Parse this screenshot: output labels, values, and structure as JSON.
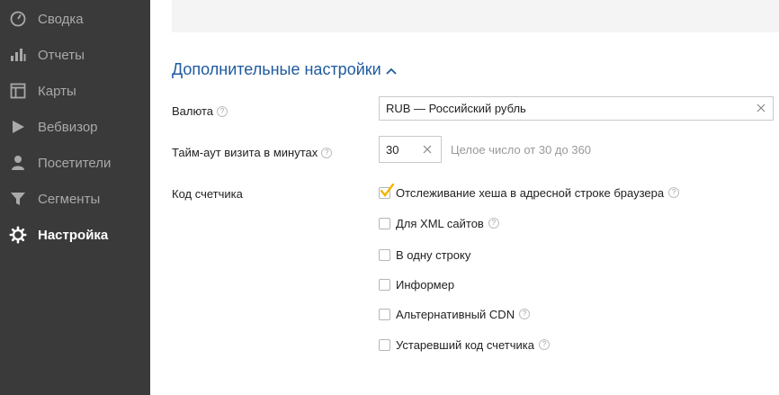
{
  "sidebar": {
    "items": [
      {
        "label": "Сводка",
        "icon": "speedometer-icon"
      },
      {
        "label": "Отчеты",
        "icon": "bar-chart-icon"
      },
      {
        "label": "Карты",
        "icon": "map-layout-icon"
      },
      {
        "label": "Вебвизор",
        "icon": "play-icon"
      },
      {
        "label": "Посетители",
        "icon": "user-icon"
      },
      {
        "label": "Сегменты",
        "icon": "funnel-icon"
      },
      {
        "label": "Настройка",
        "icon": "gear-icon",
        "active": true
      }
    ]
  },
  "section": {
    "title": "Дополнительные настройки"
  },
  "fields": {
    "currency": {
      "label": "Валюта",
      "value": "RUB — Российский рубль"
    },
    "timeout": {
      "label": "Тайм-аут визита в минутах",
      "value": "30",
      "hint": "Целое число от 30 до 360"
    },
    "counter_code": {
      "label": "Код счетчика",
      "options": [
        {
          "label": "Отслеживание хеша в адресной строке браузера",
          "checked": true,
          "help": true
        },
        {
          "label": "Для XML сайтов",
          "checked": false,
          "help": true
        },
        {
          "label": "В одну строку",
          "checked": false,
          "help": false
        },
        {
          "label": "Информер",
          "checked": false,
          "help": false
        },
        {
          "label": "Альтернативный CDN",
          "checked": false,
          "help": true
        },
        {
          "label": "Устаревший код счетчика",
          "checked": false,
          "help": true
        }
      ]
    }
  },
  "colors": {
    "sidebar_bg": "#3a3a3a",
    "accent": "#1e5a9e",
    "checkmark": "#f5b400"
  }
}
